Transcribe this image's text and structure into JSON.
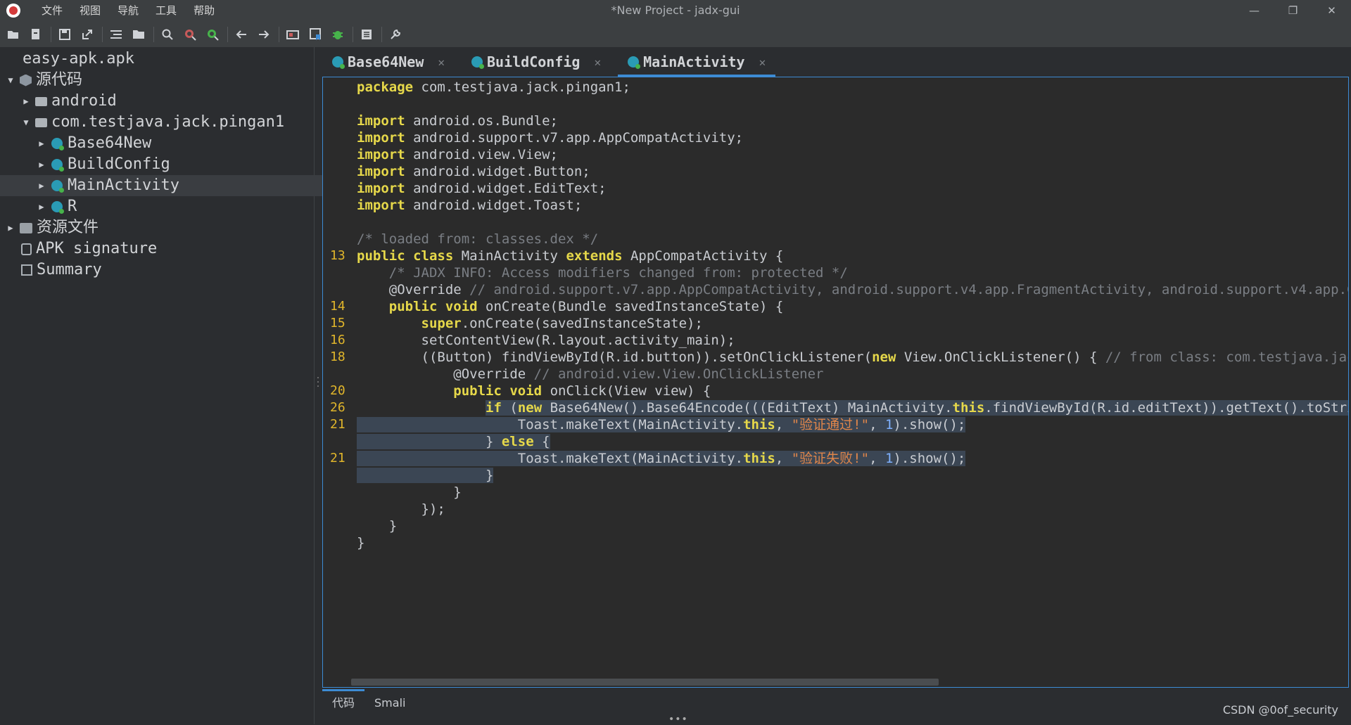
{
  "window": {
    "title": "*New Project - jadx-gui",
    "controls": [
      "—",
      "❐",
      "✕"
    ]
  },
  "menu": [
    "文件",
    "视图",
    "导航",
    "工具",
    "帮助"
  ],
  "toolbar": {
    "icons": [
      "open-icon",
      "add-files-icon",
      "save-icon",
      "export-icon",
      "sync-icon",
      "folder-icon",
      "search-icon",
      "find-class-icon",
      "find-usage-icon",
      "back-icon",
      "forward-icon",
      "deobfuscate-icon",
      "bookmark-icon",
      "debug-icon",
      "log-icon",
      "preferences-icon"
    ]
  },
  "tree": {
    "root": "easy-apk.apk",
    "source": "源代码",
    "android": "android",
    "package": "com.testjava.jack.pingan1",
    "classes": [
      "Base64New",
      "BuildConfig",
      "MainActivity",
      "R"
    ],
    "resources": "资源文件",
    "signature": "APK signature",
    "summary": "Summary"
  },
  "tabs": [
    "Base64New",
    "BuildConfig",
    "MainActivity"
  ],
  "active_tab": "MainActivity",
  "code": {
    "line_numbers": [
      "13",
      "14",
      "15",
      "16",
      "18",
      "20",
      "26",
      "21",
      "21"
    ]
  },
  "bottom_tabs": [
    "代码",
    "Smali"
  ],
  "watermark": "CSDN @0of_security",
  "colors": {
    "accent": "#3d8bd4",
    "keyword": "#e6d84a",
    "line_number": "#e0b52b",
    "string": "#e0864a",
    "comment": "#7a7e84"
  }
}
